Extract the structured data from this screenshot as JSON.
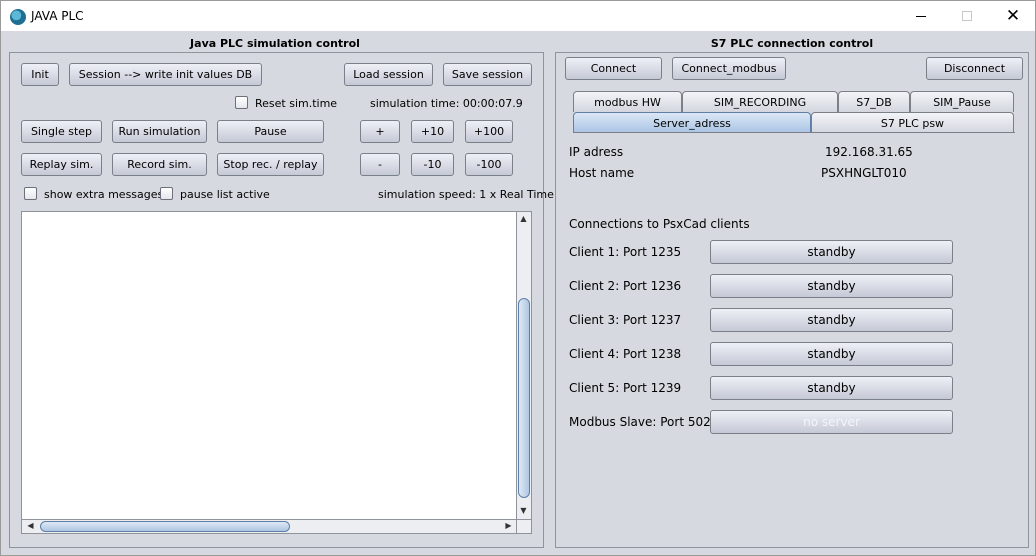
{
  "window": {
    "title": "JAVA PLC",
    "icon": "java-plc-app-icon",
    "controls": {
      "minimize": "minimize-icon",
      "maximize": "maximize-icon",
      "close": "✕"
    }
  },
  "left_panel": {
    "title": "Java PLC simulation control",
    "buttons": {
      "init": "Init",
      "session_write": "Session --> write init values DB",
      "load_session": "Load session",
      "save_session": "Save session",
      "single_step": "Single step",
      "run_simulation": "Run simulation",
      "pause": "Pause",
      "plus": "+",
      "plus10": "+10",
      "plus100": "+100",
      "replay": "Replay sim.",
      "record": "Record sim.",
      "stop_rec": "Stop rec. / replay",
      "minus": "-",
      "minus10": "-10",
      "minus100": "-100"
    },
    "reset_sim_time": "Reset sim.time",
    "simulation_time": "simulation time: 00:00:07.9",
    "show_extra_messages": "show extra messages",
    "pause_list_active": "pause list active",
    "simulation_speed": "simulation speed: 1 x Real Time",
    "log_text": ""
  },
  "right_panel": {
    "title": "S7 PLC connection control",
    "buttons": {
      "connect": "Connect",
      "connect_modbus": "Connect_modbus",
      "disconnect": "Disconnect"
    },
    "tabs_row1": [
      "modbus HW",
      "SIM_RECORDING",
      "S7_DB",
      "SIM_Pause"
    ],
    "tabs_row2": [
      "Server_adress",
      "S7 PLC psw"
    ],
    "selected_tab": "Server_adress",
    "ip_label": "IP adress",
    "ip_value": "192.168.31.65",
    "host_label": "Host name",
    "host_value": "PSXHNGLT010",
    "connections_heading": "Connections to PsxCad clients",
    "clients": [
      {
        "label": "Client 1: Port 1235",
        "status": "standby"
      },
      {
        "label": "Client 2: Port 1236",
        "status": "standby"
      },
      {
        "label": "Client 3: Port 1237",
        "status": "standby"
      },
      {
        "label": "Client 4: Port 1238",
        "status": "standby"
      },
      {
        "label": "Client 5: Port 1239",
        "status": "standby"
      }
    ],
    "modbus_label": "Modbus Slave: Port 502",
    "modbus_status": "no server"
  },
  "colors": {
    "background": "#d6d9df",
    "button_top": "#eef0f6",
    "button_bottom": "#c5c9d6",
    "selected_tab": "#a9c4e4",
    "disabled_text": "#f4f5f8"
  }
}
